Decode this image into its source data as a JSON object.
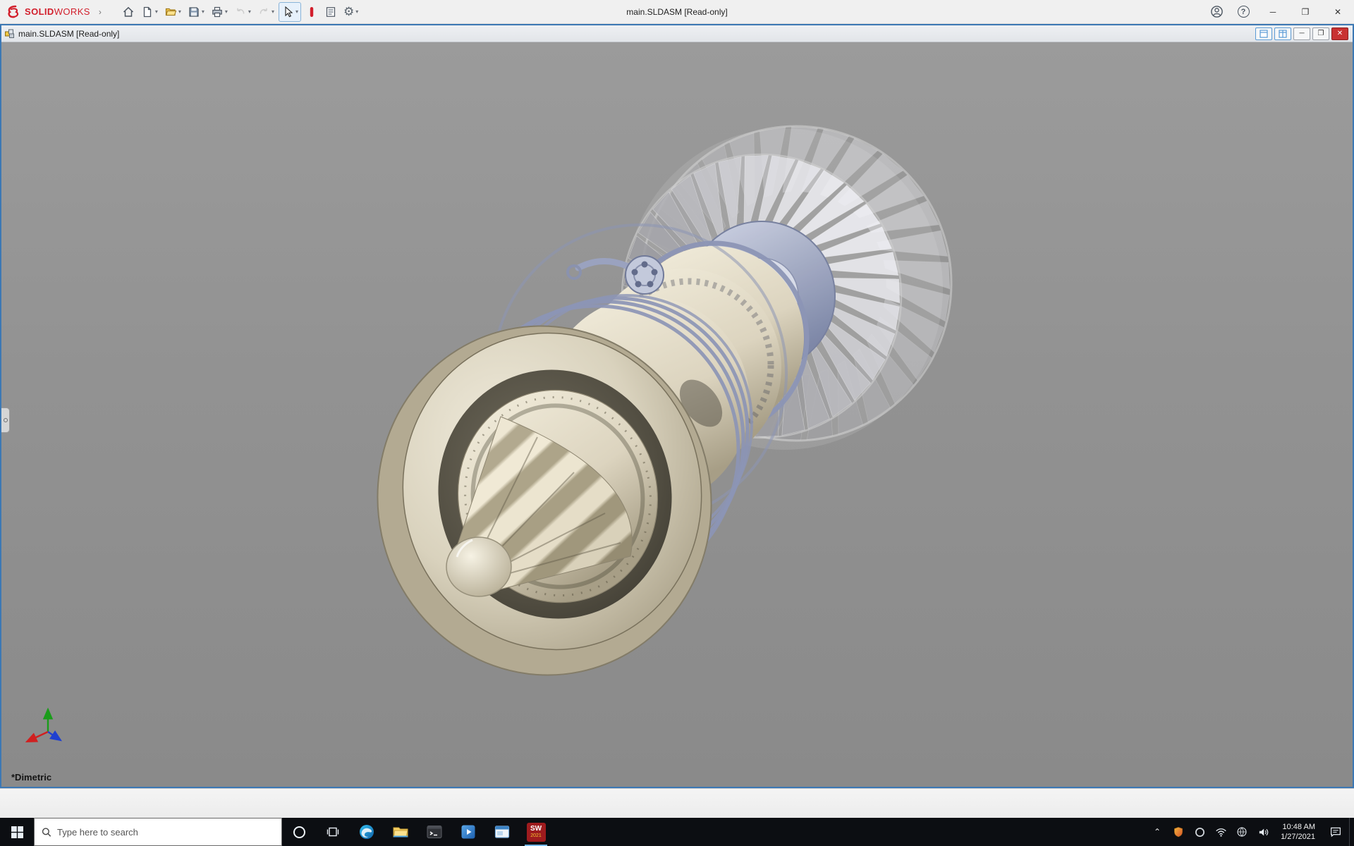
{
  "colors": {
    "brand-red": "#d21e2b",
    "frame-blue": "#3c78b4",
    "close-red": "#c83232",
    "taskbar-bg": "#0c0e12"
  },
  "titlebar": {
    "brand_bold": "SOLID",
    "brand_light": "WORKS",
    "title": "main.SLDASM [Read-only]"
  },
  "doc_window": {
    "title": "main.SLDASM [Read-only]"
  },
  "viewport": {
    "view_label": "*Dimetric"
  },
  "taskbar": {
    "search_placeholder": "Type here to search",
    "sw_text": "SW",
    "sw_badge": "2021",
    "clock_time": "10:48 AM",
    "clock_date": "1/27/2021"
  },
  "glyphs": {
    "expand": "›",
    "caret": "▾",
    "gear": "⚙",
    "help": "?",
    "minimize": "─",
    "maximize": "❐",
    "close": "✕",
    "tray_chevron": "⌃"
  }
}
